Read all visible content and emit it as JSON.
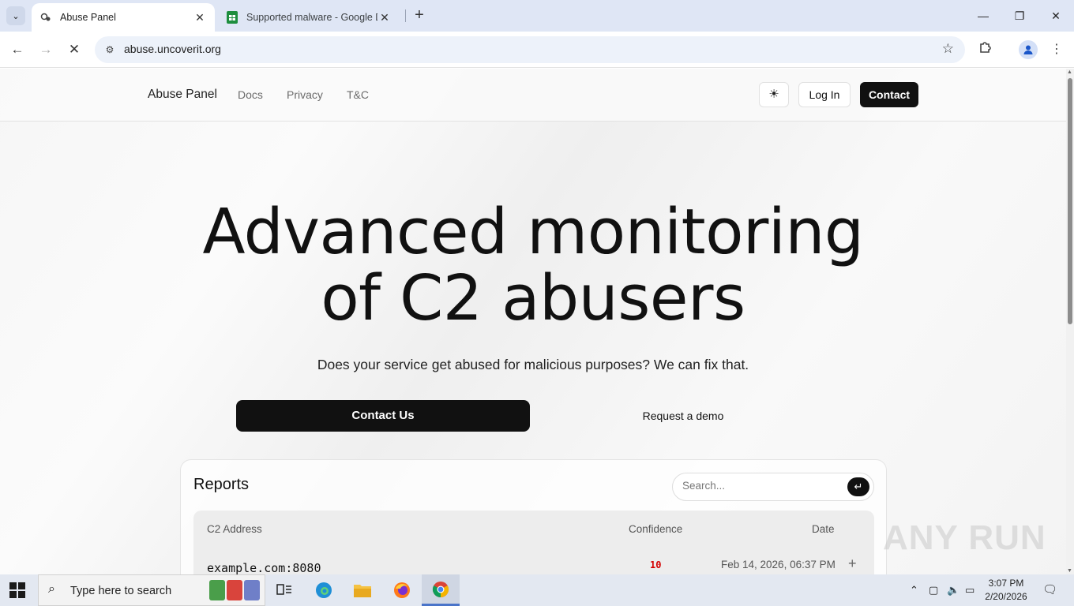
{
  "browser": {
    "tabs": [
      {
        "title": "Abuse Panel",
        "active": true,
        "favicon": "spyware-icon"
      },
      {
        "title": "Supported malware - Google D",
        "active": false,
        "favicon": "sheets-icon"
      }
    ],
    "url": "abuse.uncoverit.org"
  },
  "site": {
    "brand": "Abuse Panel",
    "nav": [
      "Docs",
      "Privacy",
      "T&C"
    ],
    "login_label": "Log In",
    "contact_label": "Contact"
  },
  "hero": {
    "title_line1": "Advanced monitoring",
    "title_line2": "of C2 abusers",
    "subtitle": "Does your service get abused for malicious purposes? We can fix that.",
    "primary_cta": "Contact Us",
    "secondary_cta": "Request a demo"
  },
  "reports": {
    "title": "Reports",
    "search_placeholder": "Search...",
    "columns": [
      "C2 Address",
      "Confidence",
      "Date"
    ],
    "rows": [
      {
        "address": "example.com:8080",
        "confidence": "10",
        "date": "Feb 14, 2026, 06:37 PM"
      }
    ]
  },
  "watermark": "ANY RUN",
  "taskbar": {
    "search_placeholder": "Type here to search",
    "time": "3:07 PM",
    "date": "2/20/2026"
  },
  "colors": {
    "accent_dark": "#111111",
    "confidence_red": "#d40000",
    "tab_bar": "#dfe6f5"
  }
}
